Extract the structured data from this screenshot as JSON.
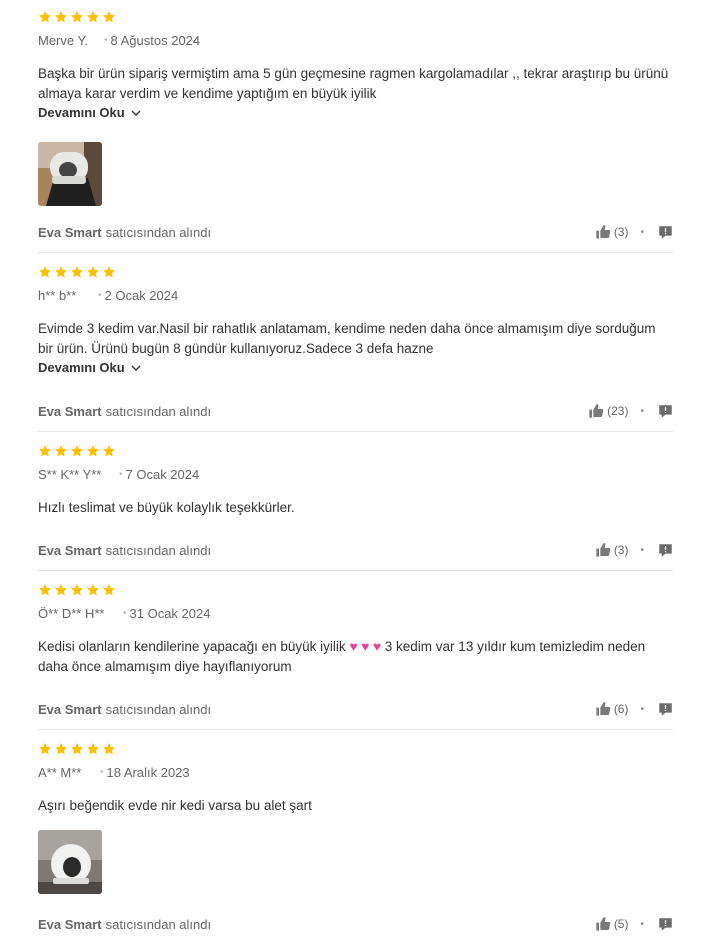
{
  "colors": {
    "star": "#ffc000",
    "text": "#333333",
    "muted": "#666666",
    "divider": "#e6e6e6"
  },
  "reviews": [
    {
      "stars": 5,
      "author": "Merve Y.",
      "date": "8 Ağustos 2024",
      "text": "Başka bir ürün sipariş vermiştim ama 5 gün geçmesine ragmen kargolamadılar ,, tekrar araştırıp bu ürünü almaya karar verdim ve kendime yaptığım en büyük iyilik",
      "read_more": "Devamını Oku",
      "has_image": true,
      "seller": "Eva Smart",
      "seller_suffix": "satıcısından alındı",
      "likes": "(3)"
    },
    {
      "stars": 5,
      "author": "h** b**",
      "date": "2 Ocak 2024",
      "text": "Evimde 3 kedim var.Nasil bir rahatlık anlatamam, kendime neden daha önce almamışım diye sorduğum bir ürün. Ürünü bugün 8 gündür kullanıyoruz.Sadece 3 defa hazne",
      "read_more": "Devamını Oku",
      "has_image": false,
      "seller": "Eva Smart",
      "seller_suffix": "satıcısından alındı",
      "likes": "(23)"
    },
    {
      "stars": 5,
      "author": "S** K** Y**",
      "date": "7 Ocak 2024",
      "text": "Hızlı teslimat ve büyük kolaylık teşekkürler.",
      "has_image": false,
      "seller": "Eva Smart",
      "seller_suffix": "satıcısından alındı",
      "likes": "(3)"
    },
    {
      "stars": 5,
      "author": "Ö** D** H**",
      "date": "31 Ocak 2024",
      "text_before": "Kedisi olanların kendilerine yapacağı en büyük iyilik",
      "hearts": "♥ ♥ ♥",
      "text_after": "3 kedim var 13 yıldır kum temizledim neden daha önce almamışım diye hayıflanıyorum",
      "has_image": false,
      "seller": "Eva Smart",
      "seller_suffix": "satıcısından alındı",
      "likes": "(6)"
    },
    {
      "stars": 5,
      "author": "A** M**",
      "date": "18 Aralık 2023",
      "text": "Aşırı beğendik evde nir kedi varsa bu alet şart",
      "has_image": true,
      "seller": "Eva Smart",
      "seller_suffix": "satıcısından alındı",
      "likes": "(5)"
    }
  ],
  "icons": {
    "star": "star-icon",
    "like": "thumbs-up-icon",
    "report": "report-flag-icon",
    "chevron": "chevron-down-icon"
  }
}
